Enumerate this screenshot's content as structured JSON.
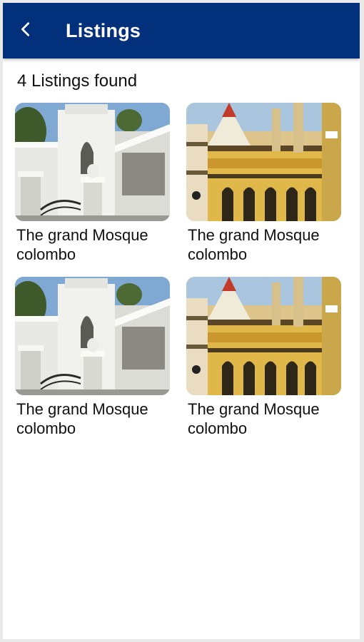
{
  "header": {
    "back_icon": "chevron-left-icon",
    "title": "Listings",
    "background": "#03307a"
  },
  "results": {
    "count_text": "4 Listings found"
  },
  "listings": [
    {
      "title_line1": "The grand Mosque",
      "title_line2": "colombo",
      "image": "white-mosque-photo"
    },
    {
      "title_line1": "The grand Mosque",
      "title_line2": "colombo",
      "image": "ornate-mosque-photo"
    },
    {
      "title_line1": "The grand Mosque",
      "title_line2": "colombo",
      "image": "white-mosque-photo"
    },
    {
      "title_line1": "The grand Mosque",
      "title_line2": "colombo",
      "image": "ornate-mosque-photo"
    }
  ]
}
